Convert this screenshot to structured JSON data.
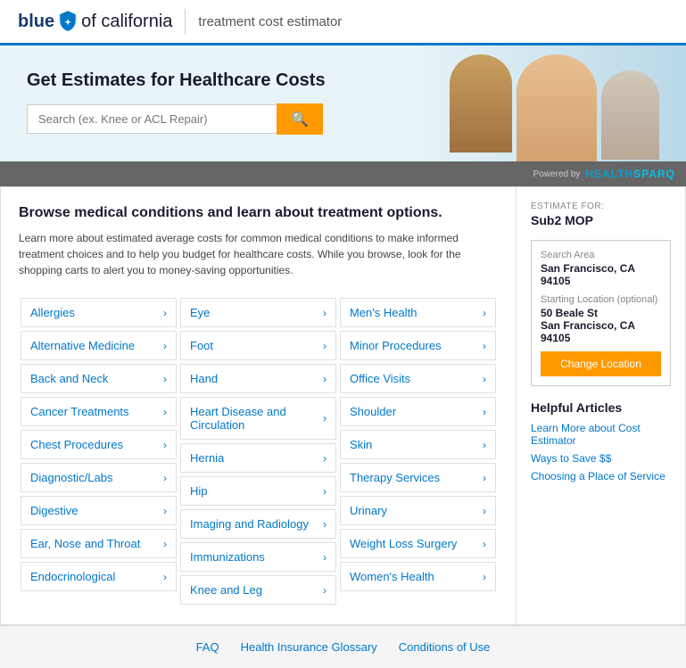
{
  "header": {
    "logo_text_before": "blue",
    "logo_text_after": "of california",
    "subtitle": "treatment cost estimator"
  },
  "hero": {
    "title": "Get Estimates for Healthcare Costs",
    "search_placeholder": "Search (ex. Knee or ACL Repair)"
  },
  "powered": {
    "label": "Powered by",
    "brand_part1": "HEALTH",
    "brand_part2": "SPARQ"
  },
  "browse": {
    "title": "Browse medical conditions and learn about treatment options.",
    "description": "Learn more about estimated average costs for common medical conditions to make informed treatment choices and to help you budget for healthcare costs. While you browse, look for the shopping carts to alert you to money-saving opportunities."
  },
  "categories": {
    "col1": [
      {
        "label": "Allergies"
      },
      {
        "label": "Alternative Medicine"
      },
      {
        "label": "Back and Neck"
      },
      {
        "label": "Cancer Treatments"
      },
      {
        "label": "Chest Procedures"
      },
      {
        "label": "Diagnostic/Labs"
      },
      {
        "label": "Digestive"
      },
      {
        "label": "Ear, Nose and Throat"
      },
      {
        "label": "Endocrinological"
      }
    ],
    "col2": [
      {
        "label": "Eye"
      },
      {
        "label": "Foot"
      },
      {
        "label": "Hand"
      },
      {
        "label": "Heart Disease and Circulation"
      },
      {
        "label": "Hernia"
      },
      {
        "label": "Hip"
      },
      {
        "label": "Imaging and Radiology"
      },
      {
        "label": "Immunizations"
      },
      {
        "label": "Knee and Leg"
      }
    ],
    "col3": [
      {
        "label": "Men's Health"
      },
      {
        "label": "Minor Procedures"
      },
      {
        "label": "Office Visits"
      },
      {
        "label": "Shoulder"
      },
      {
        "label": "Skin"
      },
      {
        "label": "Therapy Services"
      },
      {
        "label": "Urinary"
      },
      {
        "label": "Weight Loss Surgery"
      },
      {
        "label": "Women's Health"
      }
    ]
  },
  "sidebar": {
    "estimate_label": "ESTIMATE FOR:",
    "estimate_value": "Sub2 MOP",
    "search_area_label": "Search Area",
    "search_area_value": "San Francisco, CA 94105",
    "starting_location_label": "Starting Location (optional)",
    "starting_location_line1": "50 Beale St",
    "starting_location_line2": "San Francisco, CA 94105",
    "change_location_btn": "Change Location",
    "helpful_articles_title": "Helpful Articles",
    "articles": [
      {
        "label": "Learn More about Cost Estimator"
      },
      {
        "label": "Ways to Save $$"
      },
      {
        "label": "Choosing a Place of Service"
      }
    ]
  },
  "footer": {
    "links": [
      {
        "label": "FAQ"
      },
      {
        "label": "Health Insurance Glossary"
      },
      {
        "label": "Conditions of Use"
      }
    ]
  }
}
